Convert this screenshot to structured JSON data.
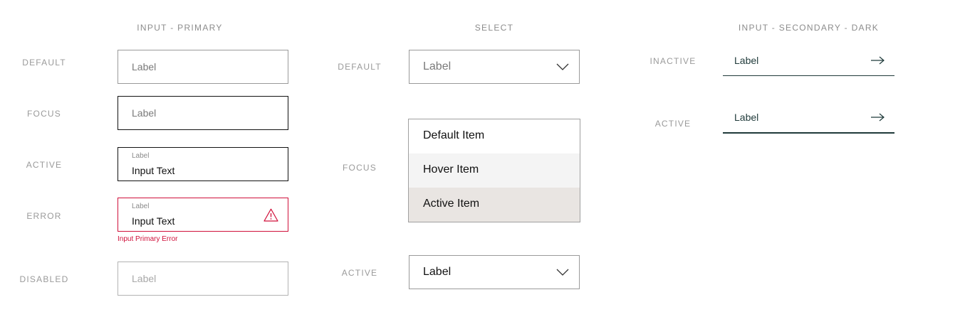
{
  "sections": {
    "input_primary": "INPUT - PRIMARY",
    "select": "SELECT",
    "input_secondary_dark": "INPUT - SECONDARY - DARK"
  },
  "input_primary": {
    "default": {
      "state": "DEFAULT",
      "placeholder": "Label"
    },
    "focus": {
      "state": "FOCUS",
      "placeholder": "Label"
    },
    "active": {
      "state": "ACTIVE",
      "label": "Label",
      "value": "Input Text"
    },
    "error": {
      "state": "ERROR",
      "label": "Label",
      "value": "Input Text",
      "message": "Input Primary Error"
    },
    "disabled": {
      "state": "DISABLED",
      "placeholder": "Label"
    }
  },
  "select": {
    "default": {
      "state": "DEFAULT",
      "value": "Label"
    },
    "focus": {
      "state": "FOCUS",
      "items": [
        "Default Item",
        "Hover Item",
        "Active Item"
      ]
    },
    "active": {
      "state": "ACTIVE",
      "value": "Label"
    }
  },
  "input_secondary": {
    "inactive": {
      "state": "INACTIVE",
      "value": "Label"
    },
    "active": {
      "state": "ACTIVE",
      "value": "Label"
    }
  },
  "colors": {
    "error": "#d0103a",
    "dark_underline": "#1f3a3a",
    "hover_bg": "#f4f4f4",
    "active_bg": "#e9e5e2"
  },
  "icons": {
    "chevron": "chevron-down-icon",
    "warning": "warning-icon",
    "arrow": "arrow-right-icon"
  }
}
